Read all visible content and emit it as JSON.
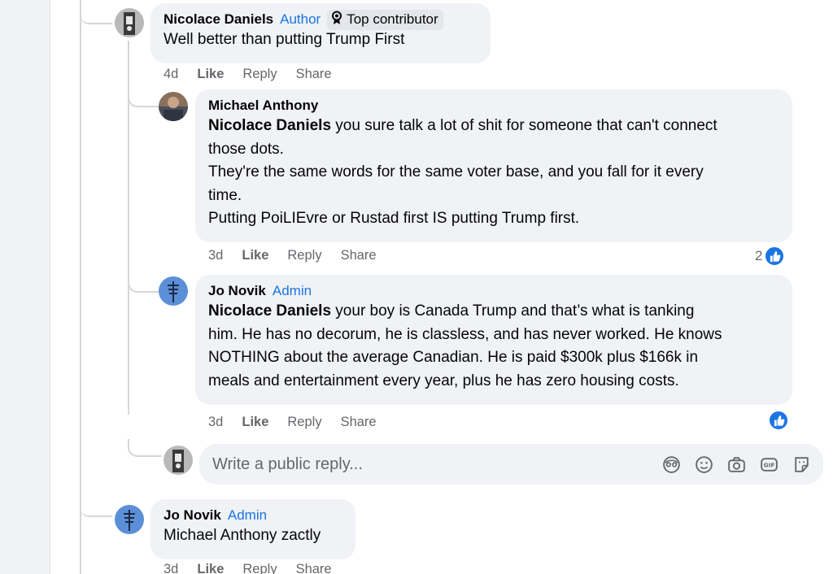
{
  "comments": [
    {
      "author": "Nicolace Daniels",
      "role": "Author",
      "badge": "Top contributor",
      "mention": "",
      "text": "Well better than putting Trump First",
      "time": "4d",
      "like": "Like",
      "reply": "Reply",
      "share": "Share"
    },
    {
      "author": "Michael Anthony",
      "role": "",
      "mention": "Nicolace Daniels",
      "line1": " you sure talk a lot of shit for someone that can't connect",
      "line2": "those dots.",
      "line3": "They're the same words for the same voter base, and you fall for it every",
      "line4": "time.",
      "line5": "Putting PoiLIEvre or Rustad first IS putting Trump first.",
      "time": "3d",
      "like": "Like",
      "reply": "Reply",
      "share": "Share",
      "reaction_count": "2"
    },
    {
      "author": "Jo Novik",
      "role": "Admin",
      "mention": "Nicolace Daniels",
      "line1": " your boy is Canada Trump and that’s what is tanking",
      "line2": "him. He has no decorum, he is classless, and has never worked. He knows",
      "line3": "NOTHING about the average Canadian. He is paid $300k plus $166k in",
      "line4": "meals and entertainment every year, plus he has zero housing costs.",
      "time": "3d",
      "like": "Like",
      "reply": "Reply",
      "share": "Share",
      "reaction_count": ""
    },
    {
      "author": "Jo Novik",
      "role": "Admin",
      "text": "Michael Anthony zactly",
      "time": "3d",
      "like": "Like",
      "reply": "Reply",
      "share": "Share"
    }
  ],
  "reply_box": {
    "placeholder": "Write a public reply...",
    "icons": [
      "avatar-sticker-icon",
      "emoji-icon",
      "camera-icon",
      "gif-icon",
      "sticker-icon"
    ]
  },
  "colors": {
    "accent": "#1b74e4",
    "bubble": "#f0f2f5",
    "meta": "#65676b"
  }
}
